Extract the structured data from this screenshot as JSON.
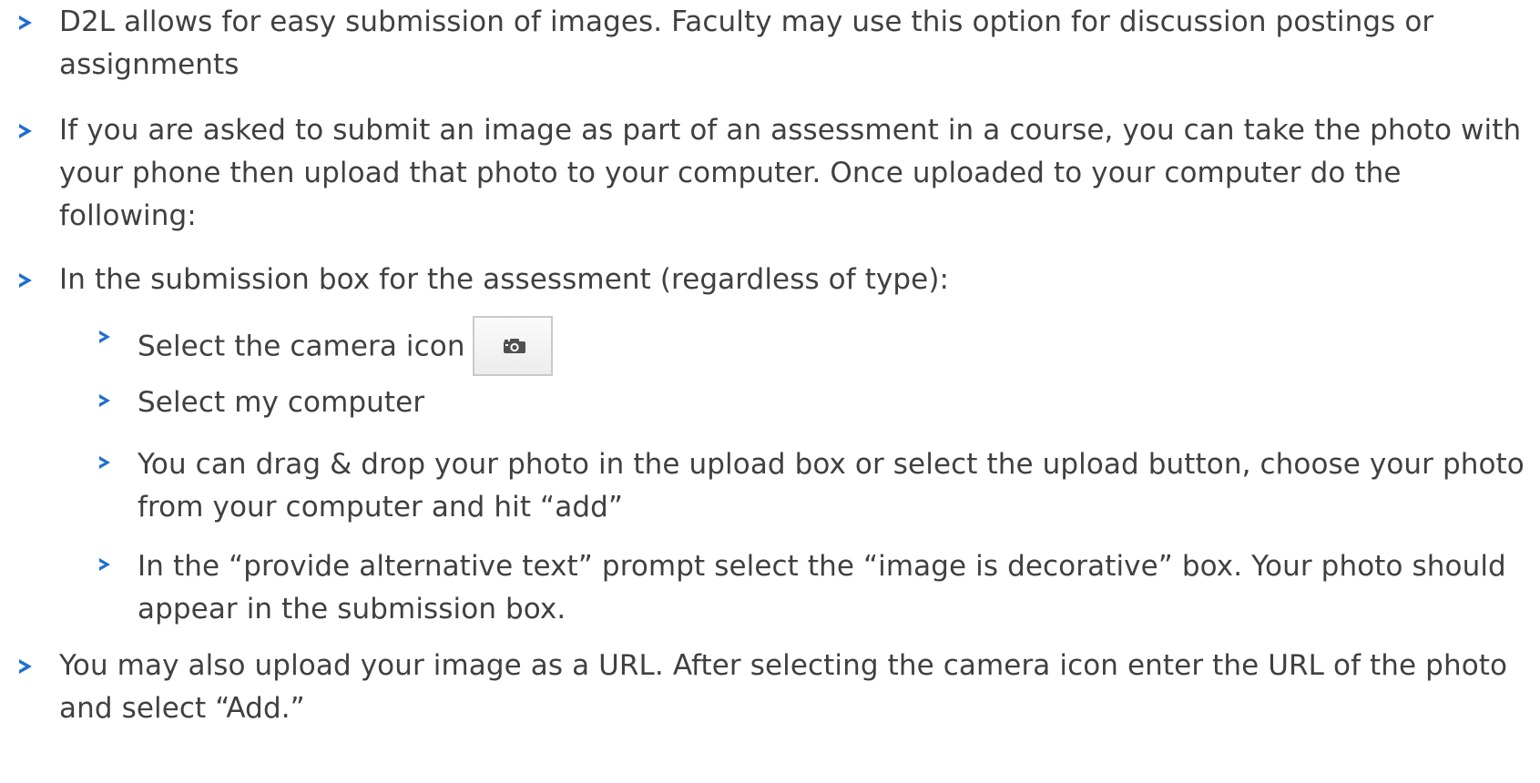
{
  "bullets": {
    "b1": "D2L allows for easy submission of images. Faculty may use this option for discussion postings or assignments",
    "b2": "If you are asked to submit an image as part of an assessment in a course, you can take the photo with your phone then upload that photo to your computer. Once uploaded to your computer do the following:",
    "b3": "In the submission box for the assessment (regardless of type):",
    "b3a": "Select the camera icon",
    "b3b": "Select my computer",
    "b3c": "You can drag & drop your photo in the upload box or select the upload button, choose your photo from your computer and hit “add”",
    "b3d": "In the “provide alternative text” prompt select the “image is decorative” box. Your photo should appear in the submission box.",
    "b4": "You may also upload your image as a URL. After selecting the camera icon enter the URL of the photo and select “Add.”"
  },
  "icons": {
    "bullet": "arrow-bullet-icon",
    "camera_button": "camera-icon"
  },
  "colors": {
    "bullet_arrow": "#1f6fd1",
    "text": "#404040"
  }
}
